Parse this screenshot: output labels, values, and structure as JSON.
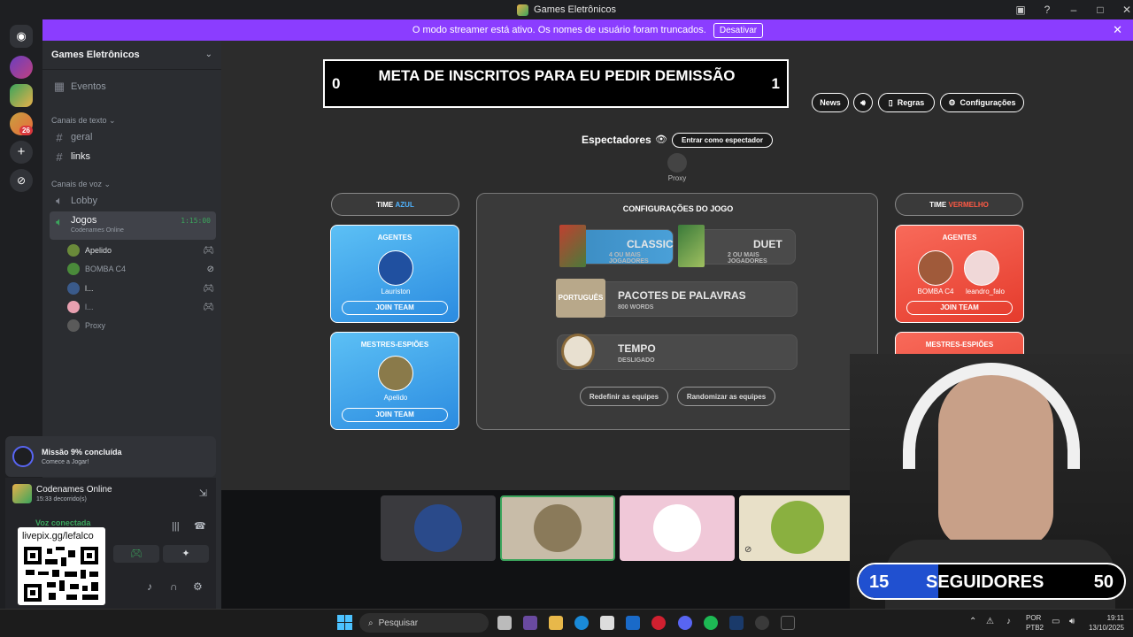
{
  "window": {
    "title": "Games Eletrônicos"
  },
  "banner": {
    "text": "O modo streamer está ativo. Os nomes de usuário foram truncados.",
    "button": "Desativar"
  },
  "sidebar": {
    "server_name": "Games Eletrônicos",
    "events": "Eventos",
    "text_category": "Canais de texto",
    "text_channels": [
      "geral",
      "links"
    ],
    "voice_category": "Canais de voz",
    "voice_channels": [
      "Lobby",
      "Jogos"
    ],
    "active_voice": {
      "name": "Jogos",
      "timer": "1:15:00",
      "status": "Codenames Online"
    },
    "voice_users": [
      "Apelido",
      "BOMBA C4",
      "l...",
      "l...",
      "Proxy"
    ]
  },
  "rail": {
    "badge_count": "26"
  },
  "mission": {
    "title": "Missão 9% concluída",
    "subtitle": "Comece a Jogar!"
  },
  "activity": {
    "name": "Codenames Online",
    "elapsed": "15:33 decorrido(s)"
  },
  "voice_panel": {
    "status": "Voz conectada"
  },
  "qr": {
    "url": "livepix.gg/lefalco"
  },
  "game": {
    "goal": {
      "left": "0",
      "text": "META DE INSCRITOS PARA EU PEDIR DEMISSÃO",
      "right": "1"
    },
    "buttons": {
      "news": "News",
      "rules": "Regras",
      "settings": "Configurações"
    },
    "spectators": {
      "label": "Espectadores",
      "join": "Entrar como espectador",
      "user": "Proxy"
    },
    "blue_team": {
      "prefix": "TIME",
      "color_word": "AZUL",
      "agents": "AGENTES",
      "agent_name": "Lauriston",
      "join": "JOIN TEAM",
      "masters": "MESTRES-ESPIÕES",
      "master_name": "Apelido",
      "join2": "JOIN TEAM"
    },
    "red_team": {
      "prefix": "TIME",
      "color_word": "VERMELHO",
      "agents": "AGENTES",
      "agent1": "BOMBA C4",
      "agent2": "leandro_falo",
      "join": "JOIN TEAM",
      "masters": "MESTRES-ESPIÕES"
    },
    "config": {
      "title": "CONFIGURAÇÕES DO JOGO",
      "classic": "CLASSIC",
      "classic_sub": "4 OU MAIS JOGADORES",
      "duet": "DUET",
      "duet_sub": "2 OU MAIS JOGADORES",
      "packs": "PACOTES DE PALAVRAS",
      "packs_sub": "800 WORDS",
      "pack_card": "PORTUGUÊS",
      "time": "TEMPO",
      "time_sub": "DESLIGADO",
      "reset": "Redefinir as equipes",
      "randomize": "Randomizar as equipes"
    }
  },
  "followers": {
    "current": "15",
    "label": "SEGUIDORES",
    "goal": "50"
  },
  "taskbar": {
    "search": "Pesquisar",
    "lang1": "POR",
    "lang2": "PTB2",
    "time": "19:11",
    "date": "13/10/2025"
  },
  "colors": {
    "blue": "#2b8be0",
    "red": "#e53b2c",
    "banner": "#8b3dff",
    "accent_blue_text": "#4fb3ff",
    "accent_red_text": "#ff5a45"
  }
}
